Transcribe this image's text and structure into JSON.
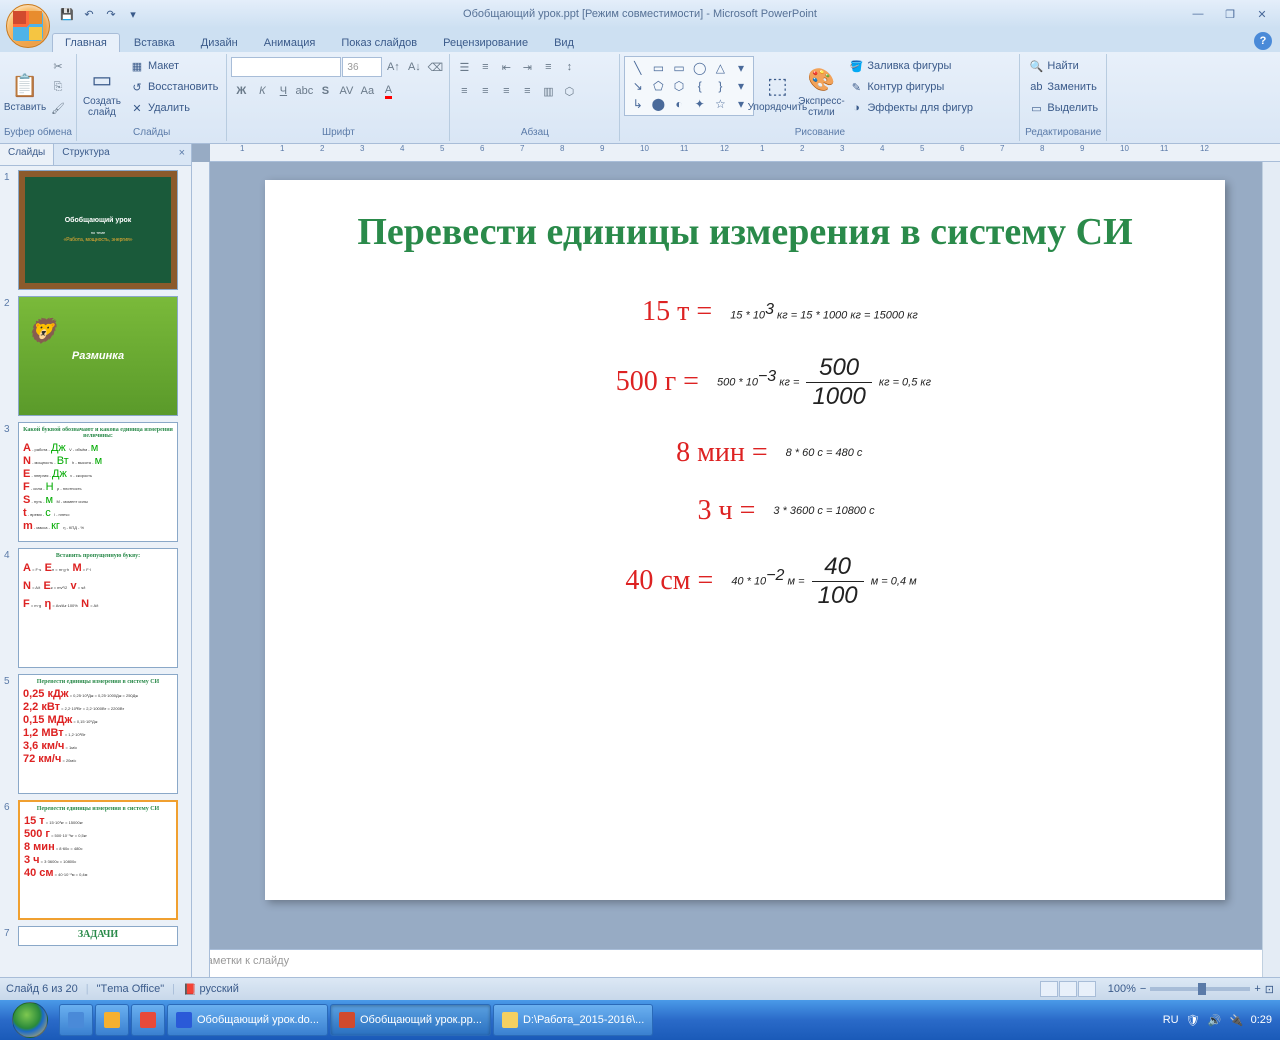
{
  "window": {
    "title": "Обобщающий урок.ppt [Режим совместимости] - Microsoft PowerPoint"
  },
  "qat": {
    "save": "💾",
    "undo": "↶",
    "redo": "↷",
    "dropdown": "▾"
  },
  "tabs": [
    "Главная",
    "Вставка",
    "Дизайн",
    "Анимация",
    "Показ слайдов",
    "Рецензирование",
    "Вид"
  ],
  "ribbon": {
    "clipboard": {
      "label": "Буфер обмена",
      "paste": "Вставить"
    },
    "slides": {
      "label": "Слайды",
      "new": "Создать слайд",
      "layout": "Макет",
      "reset": "Восстановить",
      "delete": "Удалить"
    },
    "font": {
      "label": "Шрифт",
      "size": "36"
    },
    "paragraph": {
      "label": "Абзац"
    },
    "drawing": {
      "label": "Рисование",
      "arrange": "Упорядочить",
      "styles": "Экспресс-стили",
      "fill": "Заливка фигуры",
      "outline": "Контур фигуры",
      "effects": "Эффекты для фигур"
    },
    "editing": {
      "label": "Редактирование",
      "find": "Найти",
      "replace": "Заменить",
      "select": "Выделить"
    }
  },
  "sidepanel": {
    "slides_tab": "Слайды",
    "outline_tab": "Структура",
    "thumb1_t1": "Обобщающий урок",
    "thumb1_t2": "«Работа, мощность, энергия»",
    "thumb2": "Разминка",
    "thumb3_title": "Какой буквой обозначают и какова единица измерения величины:",
    "thumb4_title": "Вставить пропущенную букву:",
    "thumb5_title": "Перевести единицы измерения в систему СИ",
    "thumb6_title": "Перевести единицы измерения в систему СИ"
  },
  "slide": {
    "title": "Перевести единицы измерения в систему СИ",
    "rows": [
      {
        "label": "15 т =",
        "math": "15 * 10³ <i>кг</i> = 15 * 1000 <i>кг</i> = 15000 <i>кг</i>"
      },
      {
        "label": "500 г =",
        "math": "500 * 10⁻³ <i>кг</i> = (500/1000) <i>кг</i> = 0,5 <i>кг</i>"
      },
      {
        "label": "8 мин =",
        "math": "8 * 60 <i>с</i> = 480 <i>с</i>"
      },
      {
        "label": "3 ч =",
        "math": "3 * 3600 <i>с</i> = 10800 <i>с</i>"
      },
      {
        "label": "40 см =",
        "math": "40 * 10⁻² <i>м</i> = (40/100) <i>м</i> = 0,4 <i>м</i>"
      }
    ]
  },
  "notes": {
    "placeholder": "Заметки к слайду"
  },
  "statusbar": {
    "slide_info": "Слайд 6 из 20",
    "theme": "\"Тema Office\"",
    "language": "русский",
    "zoom": "100%"
  },
  "taskbar": {
    "items": [
      {
        "label": "",
        "icon": "#4a8ad8"
      },
      {
        "label": "",
        "icon": "#f5b030"
      },
      {
        "label": "",
        "icon": "#e84a3a"
      },
      {
        "label": "Обобщающий урок.do...",
        "icon": "#2a5ad8"
      },
      {
        "label": "Обобщающий урок.pp...",
        "icon": "#d14a2e",
        "active": true
      },
      {
        "label": "D:\\Работа_2015-2016\\...",
        "icon": "#f5d060"
      }
    ],
    "lang": "RU",
    "time": "0:29"
  }
}
